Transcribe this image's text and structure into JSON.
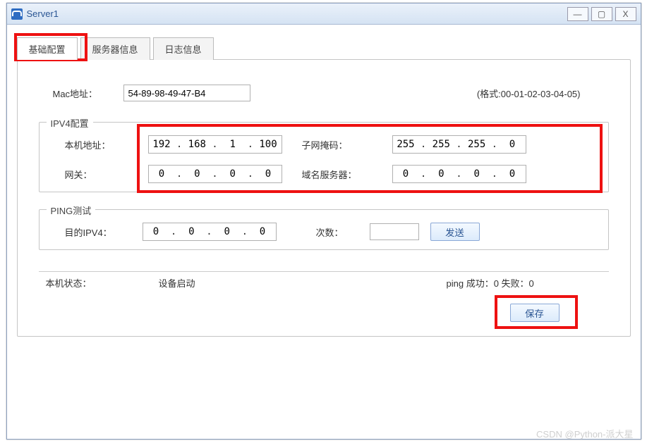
{
  "window": {
    "title": "Server1"
  },
  "tabs": {
    "t0": "基础配置",
    "t1": "服务器信息",
    "t2": "日志信息"
  },
  "mac": {
    "label": "Mac地址：",
    "value": "54-89-98-49-47-B4",
    "hint": "(格式:00-01-02-03-04-05)"
  },
  "ipv4": {
    "legend": "IPV4配置",
    "local_label": "本机地址：",
    "local": [
      "192",
      "168",
      "1",
      "100"
    ],
    "mask_label": "子网掩码：",
    "mask": [
      "255",
      "255",
      "255",
      "0"
    ],
    "gw_label": "网关：",
    "gw": [
      "0",
      "0",
      "0",
      "0"
    ],
    "dns_label": "域名服务器：",
    "dns": [
      "0",
      "0",
      "0",
      "0"
    ]
  },
  "ping": {
    "legend": "PING测试",
    "target_label": "目的IPV4：",
    "target": [
      "0",
      "0",
      "0",
      "0"
    ],
    "count_label": "次数：",
    "count": "",
    "send": "发送"
  },
  "status": {
    "label": "本机状态：",
    "value": "设备启动",
    "ping_result": "ping 成功：0 失败：0"
  },
  "save": "保存",
  "watermark": "CSDN @Python-派大星"
}
